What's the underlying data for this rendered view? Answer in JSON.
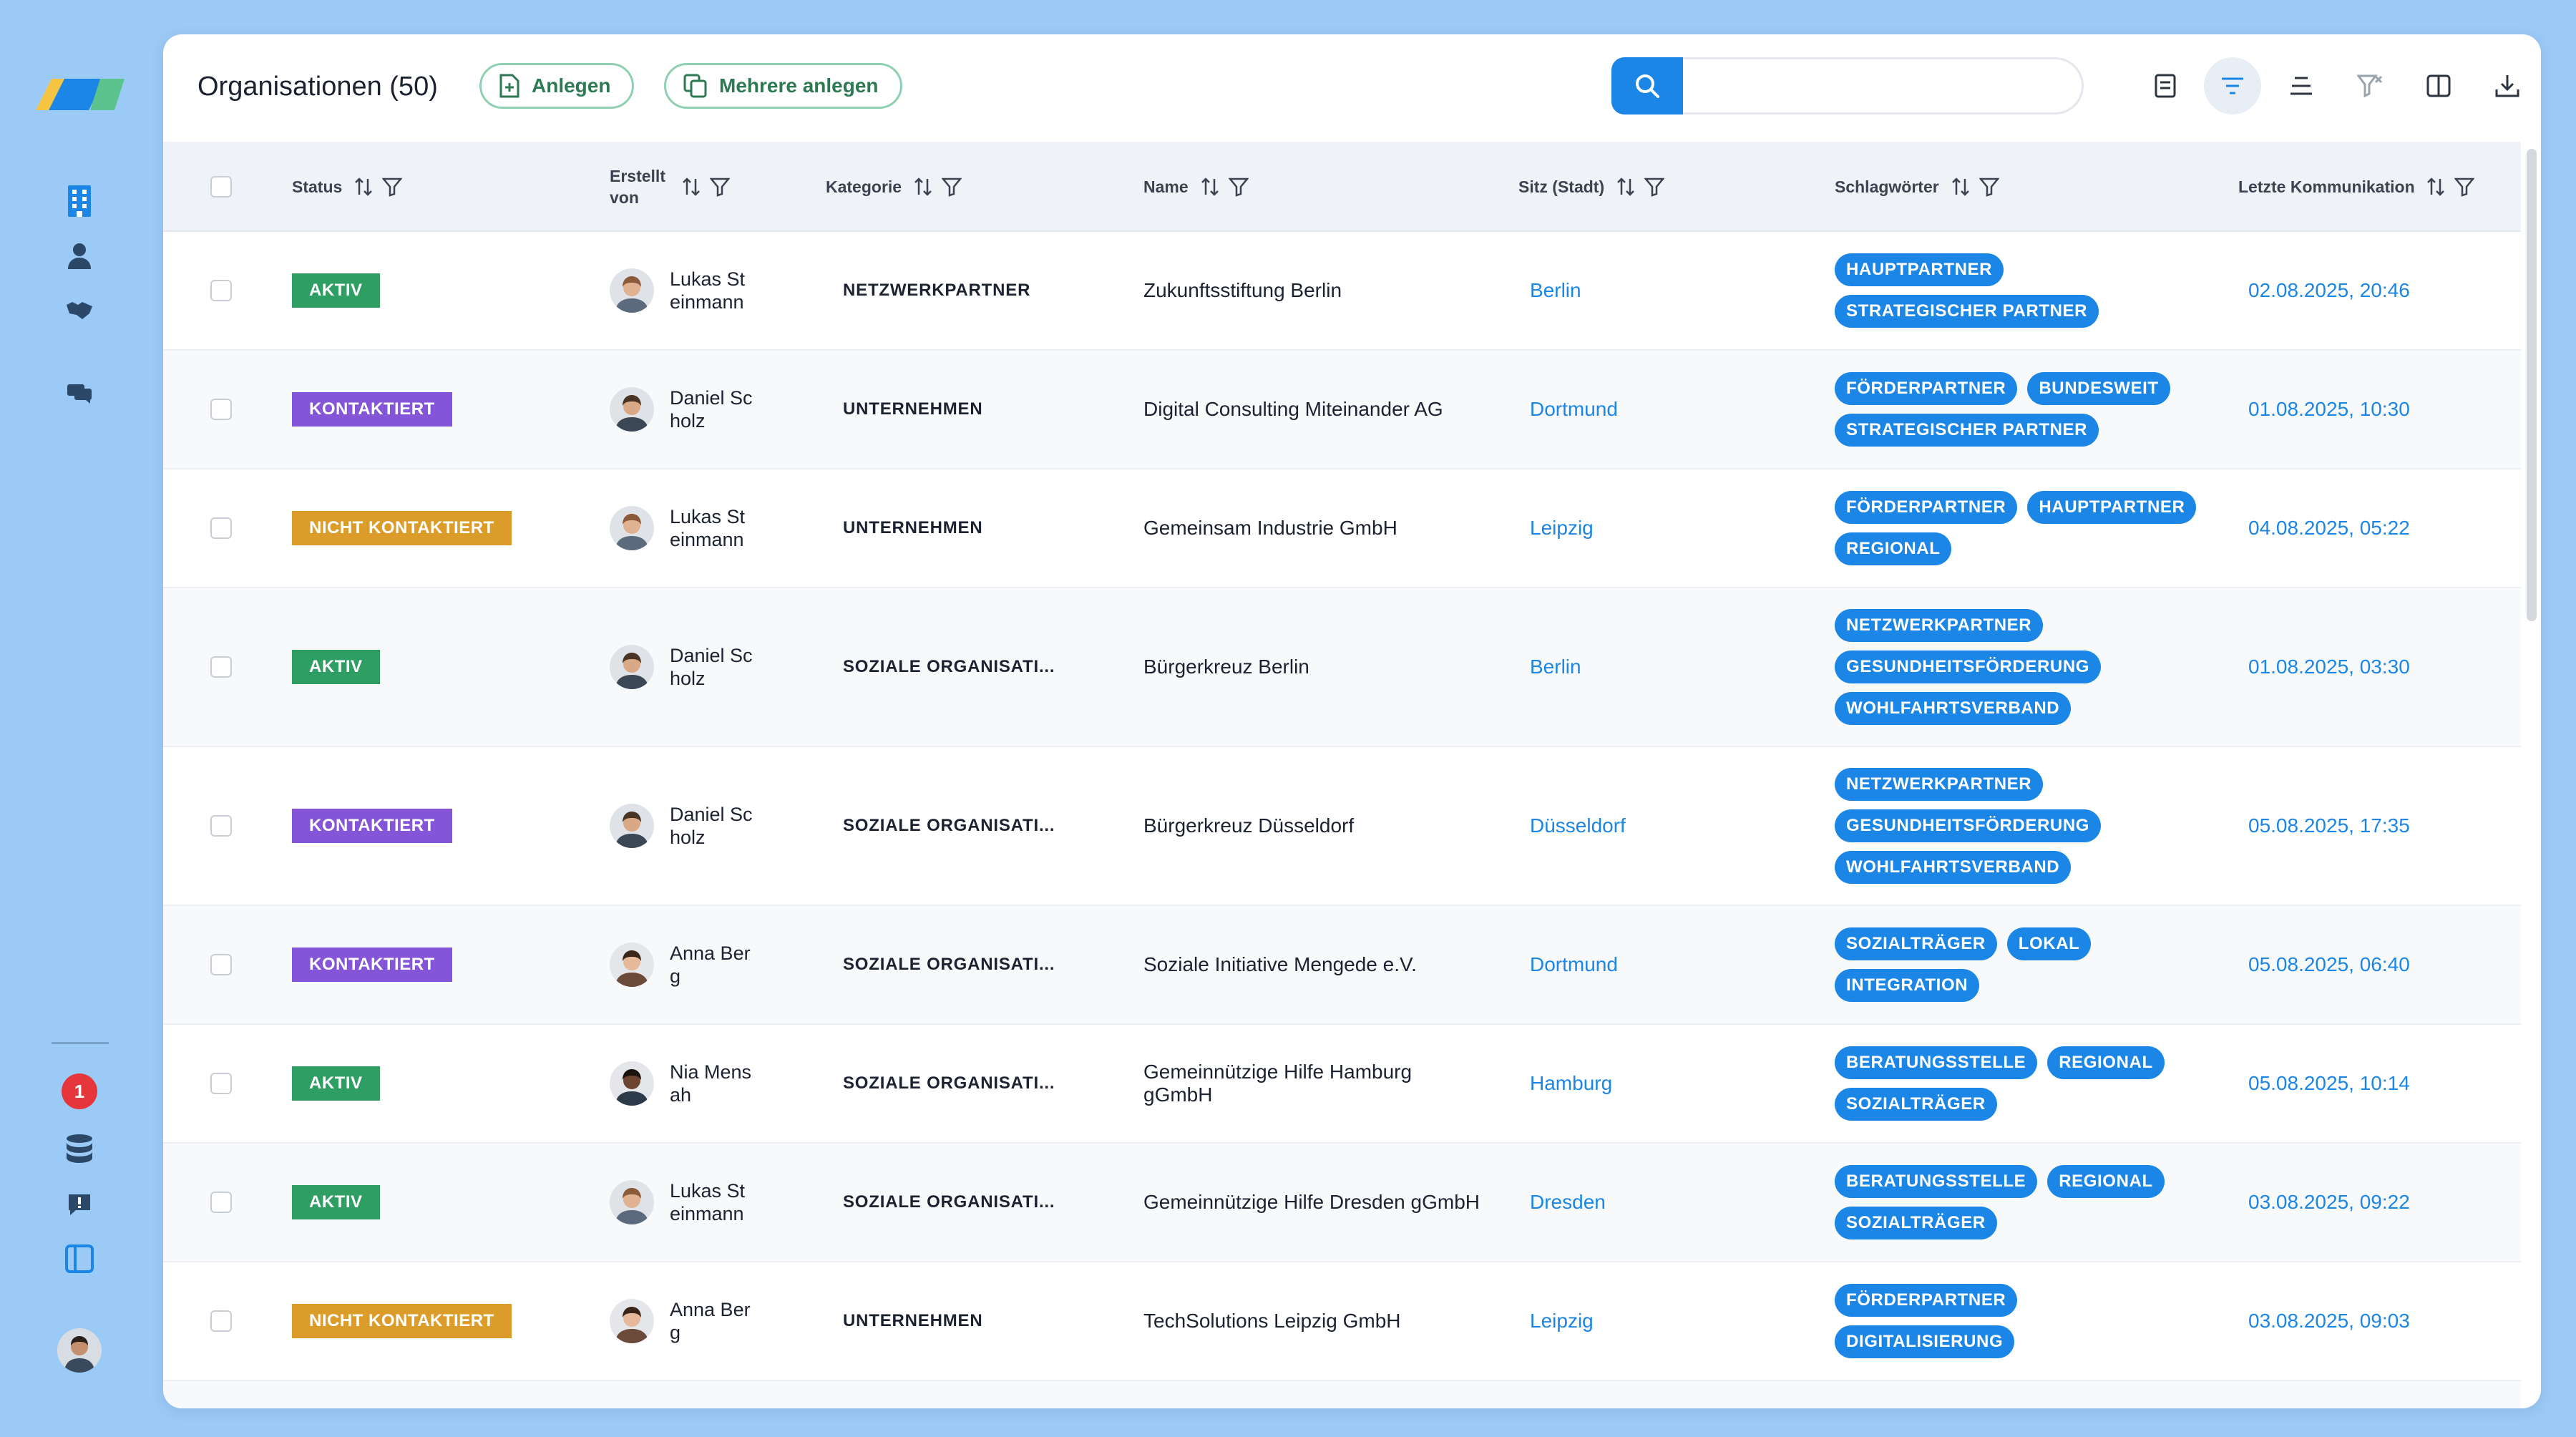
{
  "app": {
    "notifications_count": "1",
    "colors": {
      "primary": "#1b86e5",
      "success": "#2e9e62",
      "purple": "#8455d6",
      "warning": "#dc9c2a",
      "background": "#9ccaf6"
    }
  },
  "sidebar": {
    "items": [
      {
        "icon": "building-icon"
      },
      {
        "icon": "person-icon"
      },
      {
        "icon": "handshake-icon"
      },
      {
        "icon": "chat-icon"
      }
    ],
    "bottom_items": [
      {
        "icon": "database-icon"
      },
      {
        "icon": "feedback-icon"
      },
      {
        "icon": "sidebar-toggle-icon"
      }
    ]
  },
  "header": {
    "title": "Organisationen (50)",
    "create_label": "Anlegen",
    "create_multiple_label": "Mehrere anlegen",
    "search_placeholder": "",
    "search_value": ""
  },
  "table": {
    "columns": {
      "status": "Status",
      "created_by": "Erstellt von",
      "category": "Kategorie",
      "name": "Name",
      "city": "Sitz (Stadt)",
      "tags": "Schlagwörter",
      "last_comm": "Letzte Kommunikation"
    },
    "rows": [
      {
        "status": "AKTIV",
        "status_color": "#2e9e62",
        "creator": "Lukas Steinmann",
        "category": "NETZWERKPARTNER",
        "name": "Zukunftsstiftung Berlin",
        "city": "Berlin",
        "tags": [
          "HAUPTPARTNER",
          "STRATEGISCHER PARTNER"
        ],
        "date": "02.08.2025, 20:46"
      },
      {
        "status": "KONTAKTIERT",
        "status_color": "#8455d6",
        "creator": "Daniel Scholz",
        "category": "UNTERNEHMEN",
        "name": "Digital Consulting Miteinander AG",
        "city": "Dortmund",
        "tags": [
          "FÖRDERPARTNER",
          "BUNDESWEIT",
          "STRATEGISCHER PARTNER"
        ],
        "date": "01.08.2025, 10:30"
      },
      {
        "status": "NICHT KONTAKTIERT",
        "status_color": "#dc9c2a",
        "creator": "Lukas Steinmann",
        "category": "UNTERNEHMEN",
        "name": "Gemeinsam Industrie GmbH",
        "city": "Leipzig",
        "tags": [
          "FÖRDERPARTNER",
          "HAUPTPARTNER",
          "REGIONAL"
        ],
        "date": "04.08.2025, 05:22"
      },
      {
        "status": "AKTIV",
        "status_color": "#2e9e62",
        "creator": "Daniel Scholz",
        "category": "SOZIALE ORGANISATI...",
        "name": "Bürgerkreuz Berlin",
        "city": "Berlin",
        "tags": [
          "NETZWERKPARTNER",
          "GESUNDHEITSFÖRDERUNG",
          "WOHLFAHRTSVERBAND"
        ],
        "date": "01.08.2025, 03:30"
      },
      {
        "status": "KONTAKTIERT",
        "status_color": "#8455d6",
        "creator": "Daniel Scholz",
        "category": "SOZIALE ORGANISATI...",
        "name": "Bürgerkreuz Düsseldorf",
        "city": "Düsseldorf",
        "tags": [
          "NETZWERKPARTNER",
          "GESUNDHEITSFÖRDERUNG",
          "WOHLFAHRTSVERBAND"
        ],
        "date": "05.08.2025, 17:35"
      },
      {
        "status": "KONTAKTIERT",
        "status_color": "#8455d6",
        "creator": "Anna Berg",
        "category": "SOZIALE ORGANISATI...",
        "name": "Soziale Initiative Mengede e.V.",
        "city": "Dortmund",
        "tags": [
          "SOZIALTRÄGER",
          "LOKAL",
          "INTEGRATION"
        ],
        "date": "05.08.2025, 06:40"
      },
      {
        "status": "AKTIV",
        "status_color": "#2e9e62",
        "creator": "Nia Mensah",
        "category": "SOZIALE ORGANISATI...",
        "name": "Gemeinnützige Hilfe Hamburg gGmbH",
        "city": "Hamburg",
        "tags": [
          "BERATUNGSSTELLE",
          "REGIONAL",
          "SOZIALTRÄGER"
        ],
        "date": "05.08.2025, 10:14"
      },
      {
        "status": "AKTIV",
        "status_color": "#2e9e62",
        "creator": "Lukas Steinmann",
        "category": "SOZIALE ORGANISATI...",
        "name": "Gemeinnützige Hilfe Dresden gGmbH",
        "city": "Dresden",
        "tags": [
          "BERATUNGSSTELLE",
          "REGIONAL",
          "SOZIALTRÄGER"
        ],
        "date": "03.08.2025, 09:22"
      },
      {
        "status": "NICHT KONTAKTIERT",
        "status_color": "#dc9c2a",
        "creator": "Anna Berg",
        "category": "UNTERNEHMEN",
        "name": "TechSolutions Leipzig GmbH",
        "city": "Leipzig",
        "tags": [
          "FÖRDERPARTNER",
          "DIGITALISIERUNG"
        ],
        "date": "03.08.2025, 09:03"
      }
    ]
  }
}
